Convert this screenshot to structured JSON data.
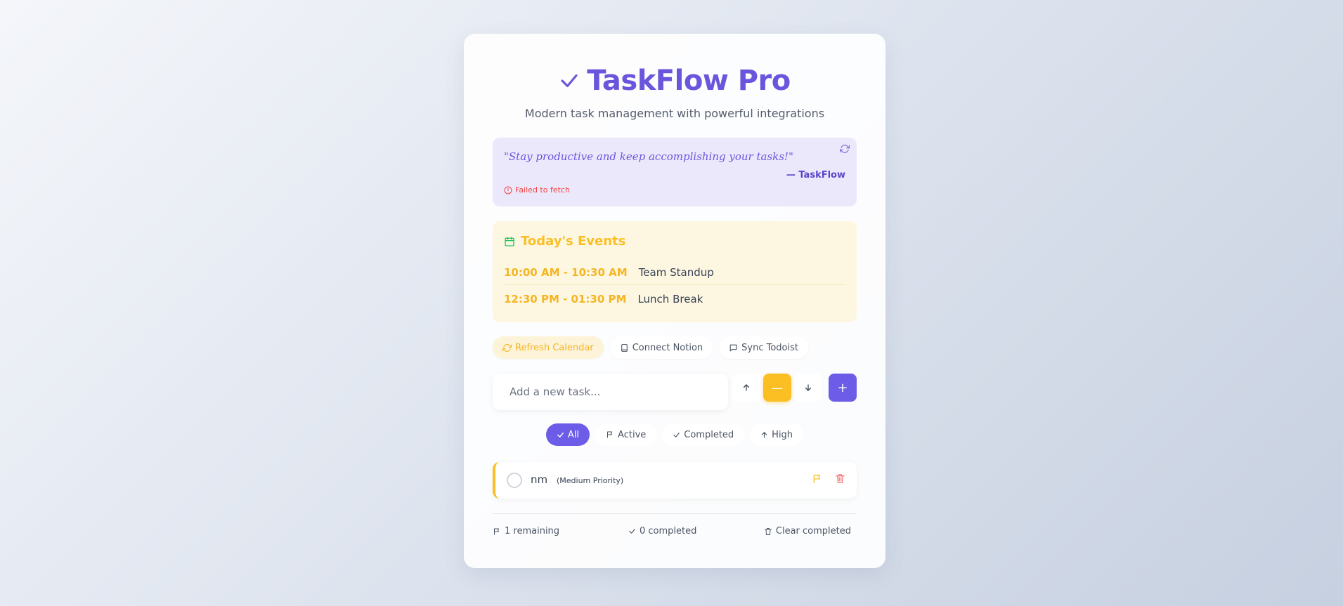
{
  "app": {
    "title": "TaskFlow Pro",
    "subtitle": "Modern task management with powerful integrations",
    "accent_color": "#6c5ce7",
    "warning_color": "#fbbf24"
  },
  "quote": {
    "text": "\"Stay productive and keep accomplishing your tasks!\"",
    "author": "— TaskFlow",
    "error": "Failed to fetch"
  },
  "events": {
    "title": "Today's Events",
    "items": [
      {
        "time": "10:00 AM - 10:30 AM",
        "name": "Team Standup"
      },
      {
        "time": "12:30 PM - 01:30 PM",
        "name": "Lunch Break"
      }
    ]
  },
  "integrations": {
    "refresh_calendar": "Refresh Calendar",
    "connect_notion": "Connect Notion",
    "sync_todoist": "Sync Todoist"
  },
  "add_task": {
    "placeholder": "Add a new task...",
    "high_icon": "↑",
    "medium_icon": "—",
    "low_icon": "↓",
    "add_icon": "+"
  },
  "filters": {
    "all": "All",
    "active": "Active",
    "completed": "Completed",
    "high": "High"
  },
  "tasks": [
    {
      "text": "nm",
      "priority_label": "(Medium Priority)",
      "priority": "medium"
    }
  ],
  "footer": {
    "remaining": "1 remaining",
    "completed": "0 completed",
    "clear": "Clear completed"
  }
}
